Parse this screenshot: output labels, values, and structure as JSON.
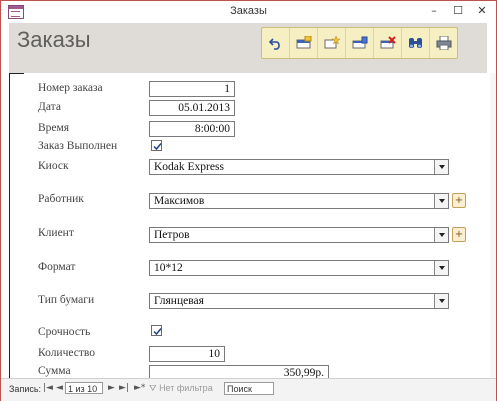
{
  "window": {
    "title": "Заказы",
    "minimize": "–",
    "maximize": "☐",
    "close": "✕"
  },
  "form": {
    "title": "Заказы"
  },
  "toolbar": {
    "buttons": [
      {
        "name": "undo-icon"
      },
      {
        "name": "save-record-icon"
      },
      {
        "name": "new-record-icon"
      },
      {
        "name": "print-record-icon"
      },
      {
        "name": "delete-record-icon"
      },
      {
        "name": "find-icon"
      },
      {
        "name": "print-icon"
      }
    ]
  },
  "fields": {
    "order_number": {
      "label": "Номер заказа",
      "value": "1"
    },
    "date": {
      "label": "Дата",
      "value": "05.01.2013"
    },
    "time": {
      "label": "Время",
      "value": "8:00:00"
    },
    "completed": {
      "label": "Заказ Выполнен",
      "checked": true
    },
    "kiosk": {
      "label": "Киоск",
      "value": "Kodak Express"
    },
    "worker": {
      "label": "Работник",
      "value": "Максимов",
      "add_label": "+"
    },
    "client": {
      "label": "Клиент",
      "value": "Петров",
      "add_label": "+"
    },
    "format": {
      "label": "Формат",
      "value": "10*12"
    },
    "paper": {
      "label": "Тип бумаги",
      "value": "Глянцевая"
    },
    "urgency": {
      "label": "Срочность",
      "checked": true
    },
    "quantity": {
      "label": "Количество",
      "value": "10"
    },
    "sum": {
      "label": "Сумма",
      "value": "350,99р."
    }
  },
  "statusbar": {
    "records_label": "Запись:",
    "first": "|◄",
    "prev": "◄",
    "current": "1 из 10",
    "next": "►",
    "last": "►|",
    "new": "►*",
    "filter_label": "Нет фильтра",
    "search_placeholder": "Поиск"
  },
  "colors": {
    "header_bg": "#dfdbd6",
    "toolbar_bg": "#f6efc4",
    "border": "#c0504d"
  }
}
